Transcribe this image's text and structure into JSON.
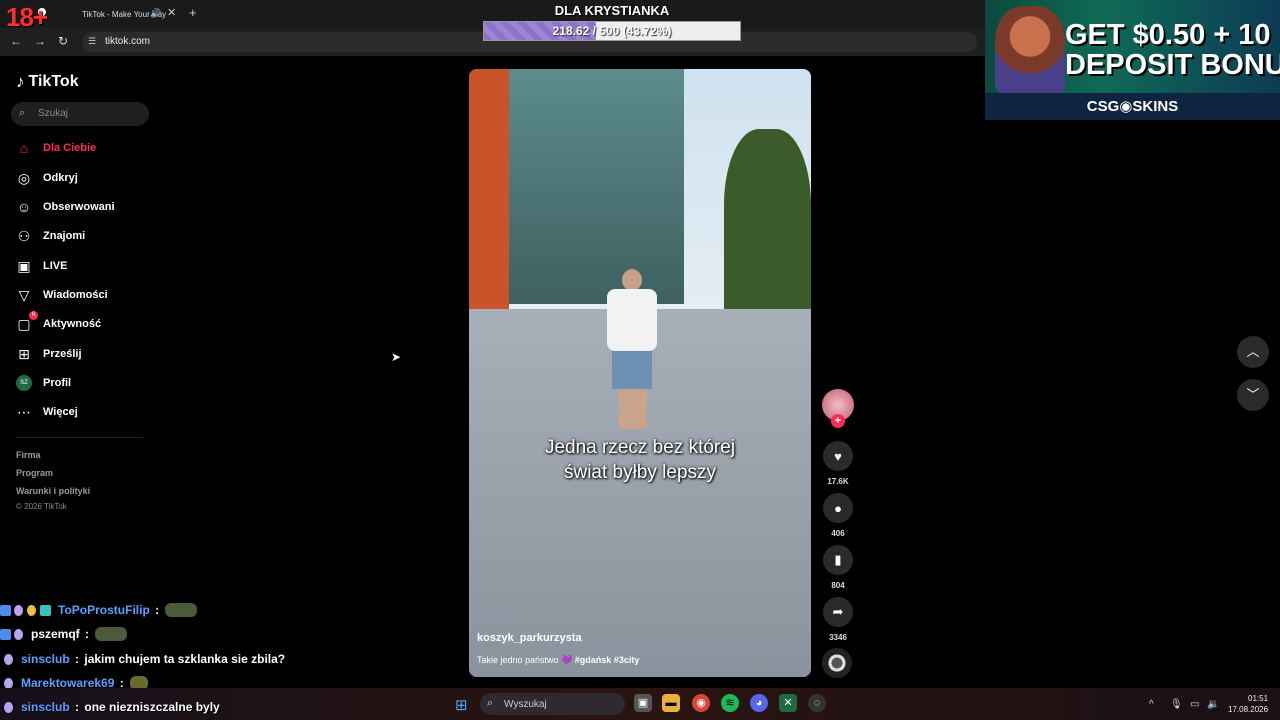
{
  "browser": {
    "tab_title": "TikTok - Make Your Day",
    "url": "tiktok.com",
    "age_badge": "18+"
  },
  "overlay": {
    "goal_title": "DLA KRYSTIANKA",
    "goal_text": "218.62 / 500 (43.72%)",
    "goal_progress": 0.4372,
    "ad_headline_1": "GET $0.50 + 10",
    "ad_headline_2": "DEPOSIT BONU",
    "ad_footer": "CSG◉SKINS"
  },
  "sidebar": {
    "logo": "TikTok",
    "search_placeholder": "Szukaj",
    "items": [
      {
        "label": "Dla Ciebie",
        "icon": "home-icon",
        "active": true
      },
      {
        "label": "Odkryj",
        "icon": "compass-icon"
      },
      {
        "label": "Obserwowani",
        "icon": "following-icon"
      },
      {
        "label": "Znajomi",
        "icon": "friends-icon"
      },
      {
        "label": "LIVE",
        "icon": "live-icon"
      },
      {
        "label": "Wiadomości",
        "icon": "send-icon"
      },
      {
        "label": "Aktywność",
        "icon": "activity-icon",
        "badge": "6"
      },
      {
        "label": "Prześlij",
        "icon": "upload-icon"
      },
      {
        "label": "Profil",
        "icon": "profile-avatar",
        "avatar_text": "SZ"
      },
      {
        "label": "Więcej",
        "icon": "more-icon"
      }
    ],
    "footer_links": [
      "Firma",
      "Program",
      "Warunki i polityki"
    ],
    "copyright": "© 2026 TikTok"
  },
  "video": {
    "caption_line1": "Jedna rzecz bez której",
    "caption_line2": "świat byłby lepszy",
    "username": "koszyk_parkurzysta",
    "description": "Takie jedno państwo",
    "hashtags": "#gdańsk #3city",
    "likes": "17.6K",
    "comments": "406",
    "saves": "804",
    "shares": "3346"
  },
  "chat": [
    {
      "user": "ToPoProstuFilip",
      "message": "",
      "user_color": "#5aa0ff"
    },
    {
      "user": "pszemqf",
      "message": "",
      "user_color": "#ffffff"
    },
    {
      "user": "sinsclub",
      "message": "jakim chujem ta szklanka sie zbila?",
      "user_color": "#5aa0ff"
    },
    {
      "user": "Marektowarek69",
      "message": "",
      "user_color": "#5aa0ff"
    },
    {
      "user": "sinsclub",
      "message": "one niezniszczalne byly",
      "user_color": "#5aa0ff"
    }
  ],
  "taskbar": {
    "search_placeholder": "Wyszukaj",
    "time": "01:51",
    "date": "17.08.2026"
  }
}
